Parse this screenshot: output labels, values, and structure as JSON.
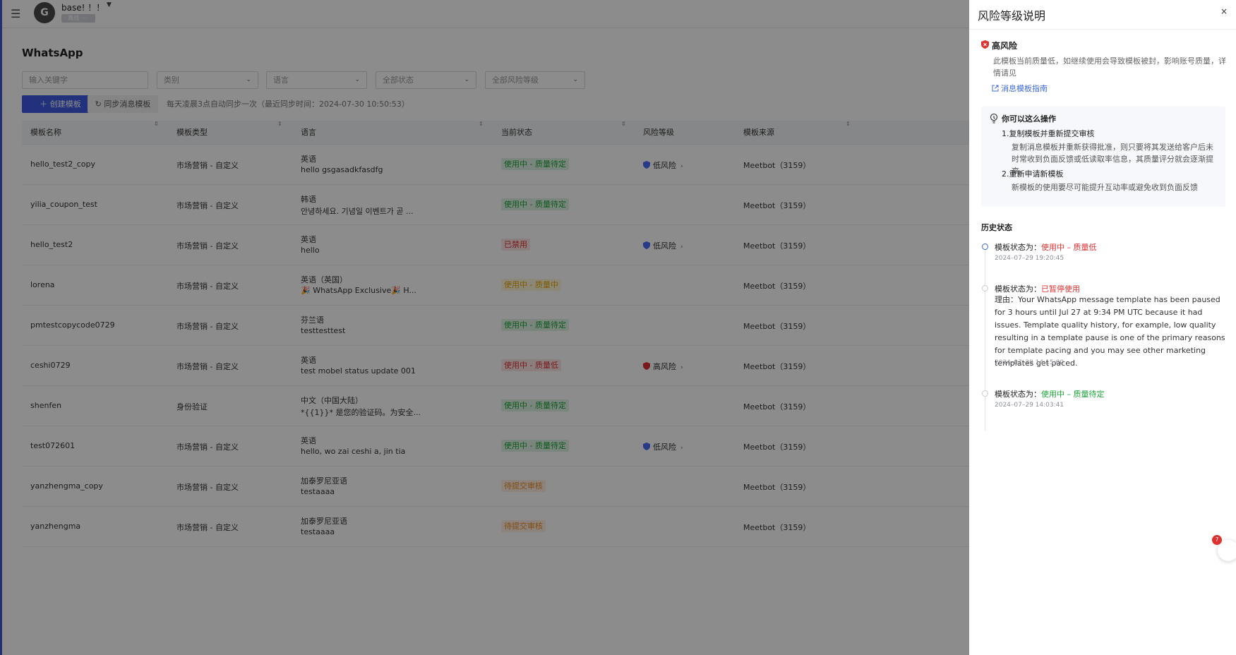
{
  "topbar": {
    "avatar_letter": "G",
    "workspace_name": "base! ！！",
    "workspace_badge": "· 离线 ···"
  },
  "page": {
    "title": "WhatsApp",
    "filters": {
      "keyword_placeholder": "输入关键字",
      "category": "类别",
      "language": "语言",
      "status": "全部状态",
      "risk": "全部风险等级"
    },
    "create_button": "创建模板",
    "sync_button": "同步消息模板",
    "sync_note": "每天凌晨3点自动同步一次（最近同步时间：2024-07-30 10:50:53）"
  },
  "table": {
    "headers": [
      "模板名称",
      "模板类型",
      "语言",
      "当前状态",
      "风险等级",
      "模板来源"
    ],
    "rows": [
      {
        "name": "hello_test2_copy",
        "type": "市场营销 - 自定义",
        "lang": "英语",
        "body": "hello gsgasadkfasdfg",
        "status": "使用中 - 质量待定",
        "status_color": "green",
        "risk": "低风险",
        "risk_level": "low",
        "source": "Meetbot（3159）"
      },
      {
        "name": "yilia_coupon_test",
        "type": "市场营销 - 自定义",
        "lang": "韩语",
        "body": "안녕하세요. 기념일 이벤트가 곧 ...",
        "status": "使用中 - 质量待定",
        "status_color": "green",
        "risk": "",
        "risk_level": "",
        "source": "Meetbot（3159）"
      },
      {
        "name": "hello_test2",
        "type": "市场营销 - 自定义",
        "lang": "英语",
        "body": "hello",
        "status": "已禁用",
        "status_color": "red",
        "risk": "低风险",
        "risk_level": "low",
        "source": "Meetbot（3159）"
      },
      {
        "name": "lorena",
        "type": "市场营销 - 自定义",
        "lang": "英语（英国）",
        "body": "🎉 WhatsApp Exclusive🎉 H...",
        "status": "使用中 - 质量中",
        "status_color": "yellow",
        "risk": "",
        "risk_level": "",
        "source": "Meetbot（3159）"
      },
      {
        "name": "pmtestcopycode0729",
        "type": "市场营销 - 自定义",
        "lang": "芬兰语",
        "body": "testtesttest",
        "status": "使用中 - 质量待定",
        "status_color": "green",
        "risk": "",
        "risk_level": "",
        "source": "Meetbot（3159）"
      },
      {
        "name": "ceshi0729",
        "type": "市场营销 - 自定义",
        "lang": "英语",
        "body": "test mobel status update 001",
        "status": "使用中 - 质量低",
        "status_color": "red",
        "risk": "高风险",
        "risk_level": "high",
        "source": "Meetbot（3159）"
      },
      {
        "name": "shenfen",
        "type": "身份验证",
        "lang": "中文（中国大陆）",
        "body": "*{{1}}* 是您的验证码。为安全...",
        "status": "使用中 - 质量待定",
        "status_color": "green",
        "risk": "",
        "risk_level": "",
        "source": "Meetbot（3159）"
      },
      {
        "name": "test072601",
        "type": "市场营销 - 自定义",
        "lang": "英语",
        "body": "hello, wo zai ceshi a, jin tia",
        "status": "使用中 - 质量待定",
        "status_color": "green",
        "risk": "低风险",
        "risk_level": "low",
        "source": "Meetbot（3159）"
      },
      {
        "name": "yanzhengma_copy",
        "type": "市场营销 - 自定义",
        "lang": "加泰罗尼亚语",
        "body": "testaaaa",
        "status": "待提交审核",
        "status_color": "orange",
        "risk": "",
        "risk_level": "",
        "source": "Meetbot（3159）"
      },
      {
        "name": "yanzhengma",
        "type": "市场营销 - 自定义",
        "lang": "加泰罗尼亚语",
        "body": "testaaaa",
        "status": "待提交审核",
        "status_color": "orange",
        "risk": "",
        "risk_level": "",
        "source": "Meetbot（3159）"
      }
    ]
  },
  "drawer": {
    "title": "风险等级说明",
    "close": "×",
    "high_risk_title": "高风险",
    "high_risk_desc": "此模板当前质量低，如继续使用会导致模板被封，影响账号质量，详情请见",
    "guide_link": "消息模板指南",
    "tips_title": "你可以这么操作",
    "tip1_title": "1.复制模板并重新提交审核",
    "tip1_desc": "复制消息模板并重新获得批准，则只要将其发送给客户后未时常收到负面反馈或低读取率信息，其质量评分就会逐渐提高。",
    "tip2_title": "2.重新申请新模板",
    "tip2_desc": "新模板的使用要尽可能提升互动率或避免收到负面反馈",
    "history_title": "历史状态",
    "history": [
      {
        "label": "模板状态为：",
        "value": "使用中 – 质量低",
        "color": "red",
        "time": "2024–07–29 19:20:45",
        "reason": ""
      },
      {
        "label": "模板状态为：",
        "value": "已暂停使用",
        "color": "red",
        "time": "2024–07–29 14:15:00",
        "reason": "理由：Your WhatsApp message template has been paused for 3 hours until Jul 27 at 9:34 PM UTC because it had issues. Template quality history, for example, low quality resulting in a template pause is one of the primary reasons for template pacing and you may see other marketing templates get paced."
      },
      {
        "label": "模板状态为：",
        "value": "使用中 – 质量待定",
        "color": "green",
        "time": "2024–07–29 14:03:41",
        "reason": ""
      }
    ]
  },
  "float_badge": "7",
  "colors": {
    "primary": "#3d5ae0",
    "success": "#1ea43a",
    "danger": "#e03131",
    "warning": "#f08a24",
    "link": "#3d6ae0"
  }
}
